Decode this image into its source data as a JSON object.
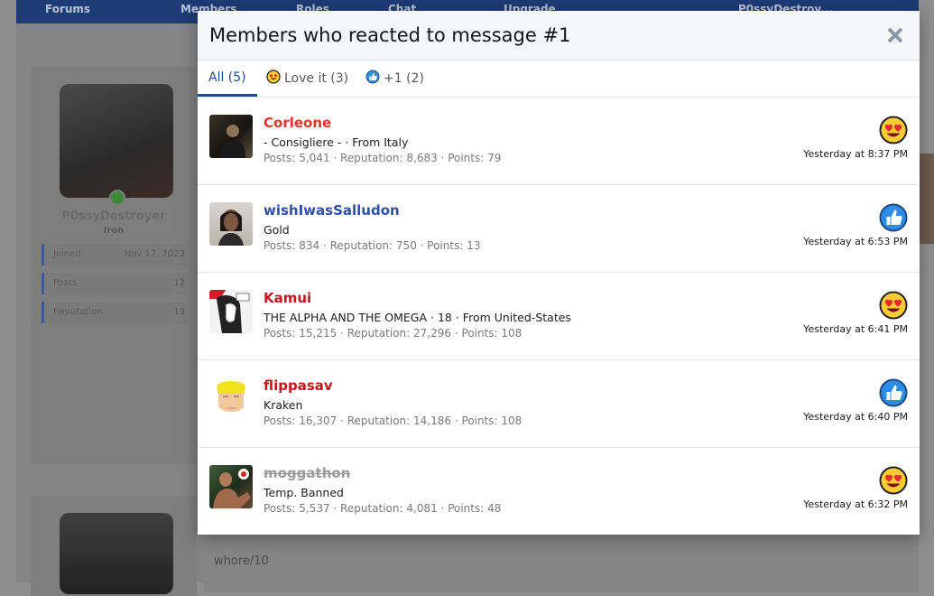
{
  "background": {
    "nav_items": [
      "Forums",
      "Members",
      "Roles",
      "Chat",
      "Upgrade",
      "P0ssyDestroy..."
    ],
    "profile_name": "P0ssyDestroyer",
    "profile_rank": "Iron",
    "stats": [
      {
        "label": "Joined",
        "value": "Nov 17, 2023"
      },
      {
        "label": "Posts",
        "value": "12"
      },
      {
        "label": "Reputation",
        "value": "13"
      }
    ],
    "post_text": "whore/10"
  },
  "modal": {
    "title": "Members who reacted to message #1",
    "close_icon": "close-icon",
    "tabs": [
      {
        "label": "All (5)",
        "icon": "",
        "active": true
      },
      {
        "label": "Love it (3)",
        "icon": "love-it-emoji-icon",
        "active": false
      },
      {
        "label": "+1 (2)",
        "icon": "thumbs-up-icon",
        "active": false
      }
    ],
    "members": [
      {
        "name": "Corleone",
        "name_color": "#e0342e",
        "title": "- Consigliere - · From Italy",
        "posts": "5,041",
        "reputation": "8,683",
        "points": "79",
        "reaction": "love-it",
        "time": "Yesterday at 8:37 PM"
      },
      {
        "name": "wishIwasSalludon",
        "name_color": "#2f4fa8",
        "title": "Gold",
        "posts": "834",
        "reputation": "750",
        "points": "13",
        "reaction": "plus-one",
        "time": "Yesterday at 6:53 PM"
      },
      {
        "name": "Kamui",
        "name_color": "#c4161c",
        "title": "THE ALPHA AND THE OMEGA · 18 · From United-States",
        "posts": "15,215",
        "reputation": "27,296",
        "points": "108",
        "reaction": "love-it",
        "time": "Yesterday at 6:41 PM"
      },
      {
        "name": "flippasav",
        "name_color": "#c4161c",
        "title": "Kraken",
        "posts": "16,307",
        "reputation": "14,186",
        "points": "108",
        "reaction": "plus-one",
        "time": "Yesterday at 6:40 PM"
      },
      {
        "name": "moggathon",
        "name_color": "#9a9a9a",
        "title": "Temp. Banned",
        "posts": "5,537",
        "reputation": "4,081",
        "points": "48",
        "reaction": "love-it",
        "time": "Yesterday at 6:32 PM"
      }
    ],
    "stat_labels": {
      "posts": "Posts:",
      "reputation": "Reputation:",
      "points": "Points:",
      "sep": " · "
    }
  }
}
